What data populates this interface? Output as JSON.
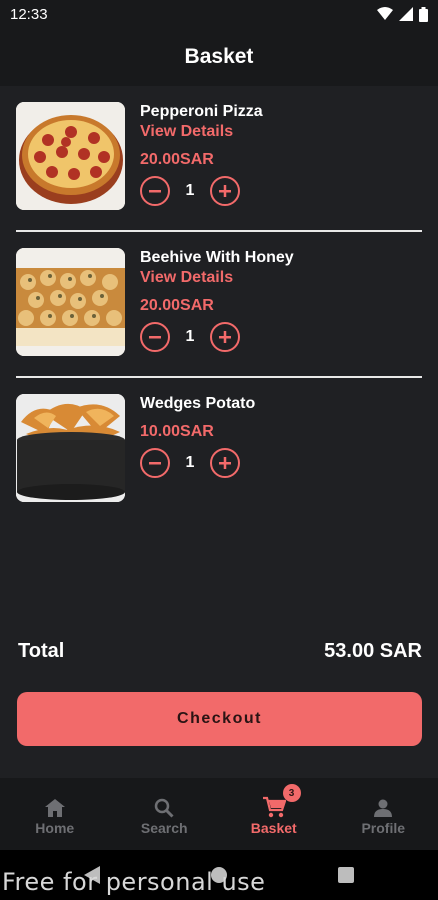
{
  "status_bar": {
    "time": "12:33"
  },
  "header": {
    "title": "Basket"
  },
  "items": [
    {
      "name": "Pepperoni Pizza",
      "details_label": "View Details",
      "price": "20.00SAR",
      "quantity": "1",
      "image": "pepperoni-pizza"
    },
    {
      "name": "Beehive With Honey",
      "details_label": "View Details",
      "price": "20.00SAR",
      "quantity": "1",
      "image": "beehive-bread"
    },
    {
      "name": "Wedges Potato",
      "price": "10.00SAR",
      "quantity": "1",
      "image": "potato-wedges"
    }
  ],
  "summary": {
    "total_label": "Total",
    "total_value": "53.00 SAR"
  },
  "checkout": {
    "label": "Checkout"
  },
  "nav": {
    "items": [
      {
        "label": "Home",
        "icon": "home-icon"
      },
      {
        "label": "Search",
        "icon": "search-icon"
      },
      {
        "label": "Basket",
        "icon": "cart-icon",
        "badge": "3",
        "active": true
      },
      {
        "label": "Profile",
        "icon": "person-icon"
      }
    ]
  },
  "watermark": "Free for personal use",
  "colors": {
    "accent": "#f26a6a",
    "background": "#1f2023",
    "bar": "#18191b"
  }
}
